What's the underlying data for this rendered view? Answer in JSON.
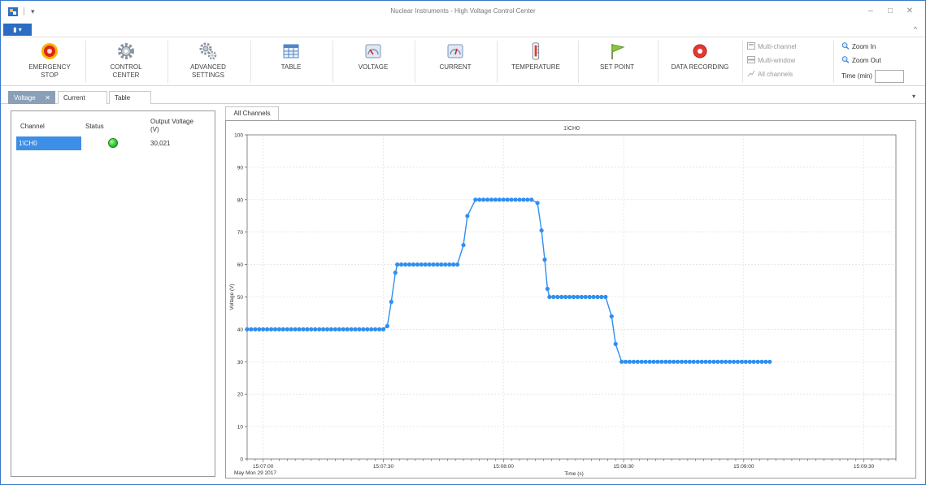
{
  "window": {
    "title": "Nuclear Instruments - High Voltage Control Center",
    "minimize": "–",
    "maximize": "□",
    "close": "✕",
    "qa_more": "▾",
    "file_button": "▮ ▾",
    "collapse_ribbon": "^"
  },
  "ribbon": {
    "buttons": [
      {
        "label1": "EMERGENCY",
        "label2": "STOP",
        "icon": "emergency-stop-icon"
      },
      {
        "label1": "CONTROL",
        "label2": "CENTER",
        "icon": "gear-icon"
      },
      {
        "label1": "ADVANCED",
        "label2": "SETTINGS",
        "icon": "gears-icon"
      },
      {
        "label1": "TABLE",
        "label2": "",
        "icon": "table-icon"
      },
      {
        "label1": "VOLTAGE",
        "label2": "",
        "icon": "voltage-gauge-icon"
      },
      {
        "label1": "CURRENT",
        "label2": "",
        "icon": "current-gauge-icon"
      },
      {
        "label1": "TEMPERATURE",
        "label2": "",
        "icon": "thermometer-icon"
      },
      {
        "label1": "SET POINT",
        "label2": "",
        "icon": "flag-icon"
      },
      {
        "label1": "DATA RECORDING",
        "label2": "",
        "icon": "record-icon"
      }
    ],
    "view_options": {
      "multi_channel": "Multi-channel",
      "multi_window": "Multi-window",
      "all_channels": "All channels"
    },
    "zoom": {
      "zoom_in": "Zoom In",
      "zoom_out": "Zoom Out",
      "time_label": "Time (min)",
      "time_value": ""
    }
  },
  "doc_tabs": [
    {
      "label": "Voltage",
      "active": true,
      "close": "✕"
    },
    {
      "label": "Current",
      "active": false
    },
    {
      "label": "Table",
      "active": false
    }
  ],
  "tab_dropdown": "▾",
  "channel_grid": {
    "headers": {
      "channel": "Channel",
      "status": "Status",
      "output1": "Output Voltage",
      "output2": "(V)"
    },
    "rows": [
      {
        "channel": "1\\CH0",
        "status": "ok",
        "output_voltage": "30,021"
      }
    ]
  },
  "chart_tab": "All Channels",
  "colors": {
    "accent": "#2b6cc4",
    "series": "#2f8ff0",
    "status_ok": "#3bd23b"
  },
  "chart_data": {
    "type": "line",
    "title": "1\\CH0",
    "xlabel": "Time (s)",
    "ylabel": "Voltage (V)",
    "x_date_label": "May Mon 29 2017",
    "xlim": [
      416,
      578
    ],
    "ylim": [
      0,
      100
    ],
    "yticks": [
      0,
      10,
      20,
      30,
      40,
      50,
      60,
      70,
      80,
      90,
      100
    ],
    "xticks": [
      {
        "t": 420,
        "label": "15:07:00"
      },
      {
        "t": 450,
        "label": "15:07:30"
      },
      {
        "t": 480,
        "label": "15:08:00"
      },
      {
        "t": 510,
        "label": "15:08:30"
      },
      {
        "t": 540,
        "label": "15:09:00"
      },
      {
        "t": 570,
        "label": "15:09:30"
      }
    ],
    "grid": true,
    "series": [
      {
        "segments": [
          {
            "t0": 416,
            "t1": 450,
            "v": 40
          },
          {
            "t0": 453.5,
            "t1": 469,
            "v": 60
          },
          {
            "t0": 473,
            "t1": 487.5,
            "v": 80
          },
          {
            "t0": 491.5,
            "t1": 506,
            "v": 50
          },
          {
            "t0": 509.5,
            "t1": 547,
            "v": 30
          }
        ],
        "transitions": [
          {
            "t": 451,
            "v": 41
          },
          {
            "t": 452,
            "v": 48.5
          },
          {
            "t": 453,
            "v": 57.5
          },
          {
            "t": 470,
            "v": 66
          },
          {
            "t": 471,
            "v": 75
          },
          {
            "t": 488.5,
            "v": 79
          },
          {
            "t": 489.5,
            "v": 70.5
          },
          {
            "t": 490.3,
            "v": 61.5
          },
          {
            "t": 491,
            "v": 52.5
          },
          {
            "t": 507,
            "v": 44
          },
          {
            "t": 508,
            "v": 35.5
          }
        ]
      }
    ]
  }
}
